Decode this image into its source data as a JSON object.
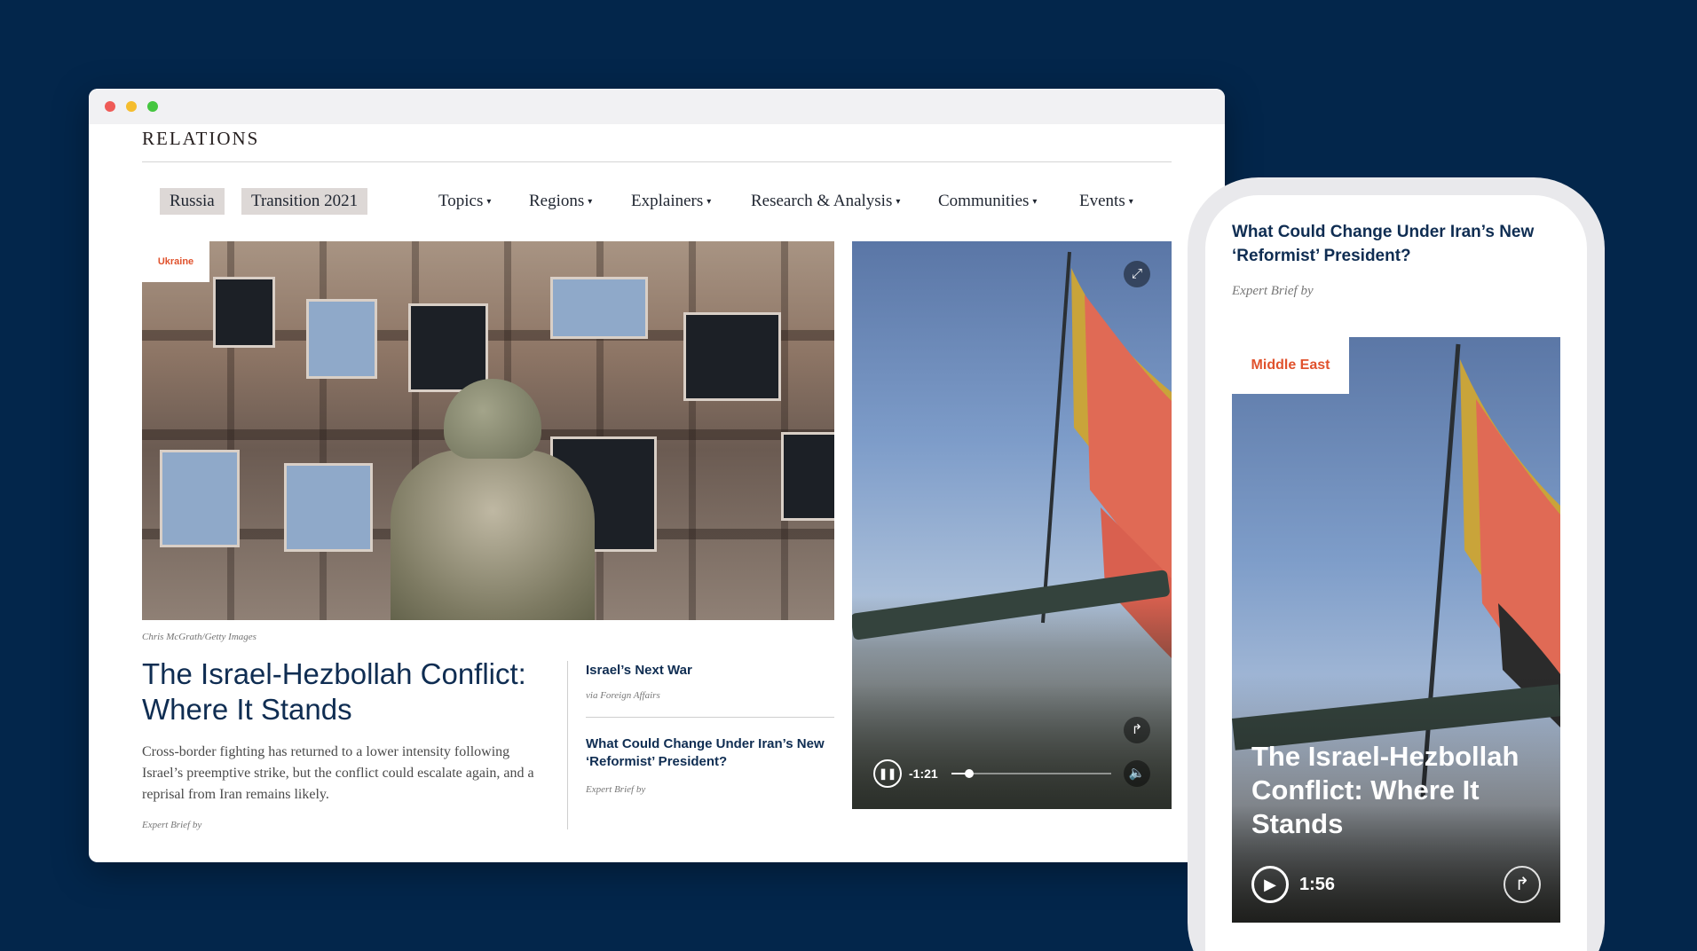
{
  "desktop": {
    "brand": "RELATIONS",
    "nav": [
      {
        "label": "Russia",
        "dropdown": false
      },
      {
        "label": "Transition 2021",
        "dropdown": false
      },
      {
        "label": "Topics",
        "dropdown": true
      },
      {
        "label": "Regions",
        "dropdown": true
      },
      {
        "label": "Explainers",
        "dropdown": true
      },
      {
        "label": "Research & Analysis",
        "dropdown": true
      },
      {
        "label": "Communities",
        "dropdown": true
      },
      {
        "label": "Events",
        "dropdown": true
      }
    ],
    "caret": "▾",
    "hero": {
      "tag": "Ukraine",
      "credit": "Chris McGrath/Getty Images",
      "headline": "The Israel-Hezbollah Conflict: Where It Stands",
      "dek": "Cross-border fighting has returned to a lower intensity following Israel’s preemptive strike, but the conflict could escalate again, and a reprisal from Iran remains likely.",
      "byline": "Expert Brief by"
    },
    "side": [
      {
        "title": "Israel’s Next War",
        "sub": "via Foreign Affairs"
      },
      {
        "title": "What Could Change Under Iran’s New ‘Reformist’ President?",
        "sub": "Expert Brief by"
      }
    ],
    "video": {
      "time": "-1:21",
      "progress": 0.11,
      "pause_icon": "❚❚",
      "expand_icon": "⤢",
      "share_icon": "↱",
      "volume_icon": "🔈"
    }
  },
  "mobile": {
    "title": "What Could Change Under Iran’s New ‘Reformist’ President?",
    "byline": "Expert Brief by",
    "card": {
      "tag": "Middle East",
      "headline": "The Israel-Hezbollah Conflict: Where It Stands",
      "duration": "1:56",
      "play_icon": "▶",
      "share_icon": "↱"
    }
  },
  "colors": {
    "background": "#03264b",
    "accent_orange": "#e0522d",
    "headline_navy": "#0f2d52"
  }
}
